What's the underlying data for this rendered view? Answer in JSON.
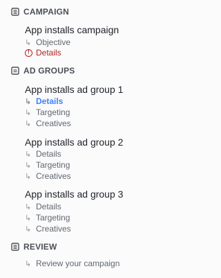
{
  "campaign": {
    "header": "CAMPAIGN",
    "icon": "document-stack-icon",
    "title": "App installs campaign",
    "items": [
      {
        "label": "Objective",
        "state": "normal"
      },
      {
        "label": "Details",
        "state": "error"
      }
    ]
  },
  "ad_groups": {
    "header": "AD GROUPS",
    "icon": "ad-set-icon",
    "groups": [
      {
        "title": "App installs ad group 1",
        "items": [
          {
            "label": "Details",
            "state": "active"
          },
          {
            "label": "Targeting",
            "state": "normal"
          },
          {
            "label": "Creatives",
            "state": "normal"
          }
        ]
      },
      {
        "title": "App installs ad group 2",
        "items": [
          {
            "label": "Details",
            "state": "normal"
          },
          {
            "label": "Targeting",
            "state": "normal"
          },
          {
            "label": "Creatives",
            "state": "normal"
          }
        ]
      },
      {
        "title": "App installs ad group 3",
        "items": [
          {
            "label": "Details",
            "state": "normal"
          },
          {
            "label": "Targeting",
            "state": "normal"
          },
          {
            "label": "Creatives",
            "state": "normal"
          }
        ]
      }
    ]
  },
  "review": {
    "header": "REVIEW",
    "icon": "review-list-icon",
    "items": [
      {
        "label": "Review your campaign",
        "state": "normal"
      }
    ]
  },
  "colors": {
    "active": "#4080ff",
    "error": "#b2231d",
    "text": "#1d2129",
    "muted": "#606770"
  }
}
